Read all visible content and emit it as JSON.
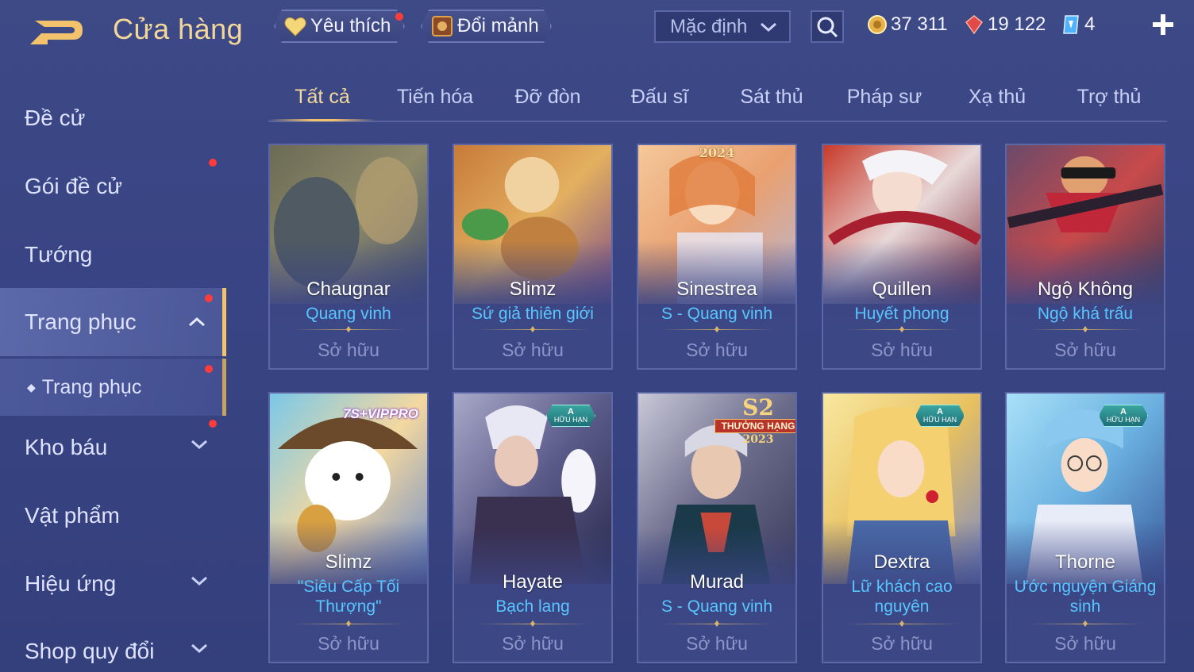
{
  "header": {
    "title": "Cửa hàng",
    "favorites_label": "Yêu thích",
    "exchange_label": "Đổi mảnh",
    "sort_value": "Mặc định",
    "gold": "37 311",
    "ruby": "19 122",
    "gems": "4"
  },
  "sidebar": {
    "items": [
      {
        "label": "Đề cử"
      },
      {
        "label": "Gói đề cử"
      },
      {
        "label": "Tướng"
      },
      {
        "label": "Trang phục"
      },
      {
        "label": "Trang phục"
      },
      {
        "label": "Kho báu"
      },
      {
        "label": "Vật phẩm"
      },
      {
        "label": "Hiệu ứng"
      },
      {
        "label": "Shop quy đổi"
      }
    ]
  },
  "tabs": [
    "Tất cả",
    "Tiến hóa",
    "Đỡ đòn",
    "Đấu sĩ",
    "Sát thủ",
    "Pháp sư",
    "Xạ thủ",
    "Trợ thủ"
  ],
  "cards": [
    {
      "hero": "Chaugnar",
      "skin": "Quang vinh",
      "status": "Sở hữu"
    },
    {
      "hero": "Slimz",
      "skin": "Sứ giả thiên giới",
      "status": "Sở hữu"
    },
    {
      "hero": "Sinestrea",
      "skin": "S - Quang vinh",
      "status": "Sở hữu",
      "badge": "2024"
    },
    {
      "hero": "Quillen",
      "skin": "Huyết phong",
      "status": "Sở hữu"
    },
    {
      "hero": "Ngộ Không",
      "skin": "Ngộ khá trấu",
      "status": "Sở hữu"
    },
    {
      "hero": "Slimz",
      "skin": "\"Siêu Cấp Tối Thượng\"",
      "status": "Sở hữu",
      "badge": "7S+VIPPRO"
    },
    {
      "hero": "Hayate",
      "skin": "Bạch lang",
      "status": "Sở hữu",
      "badge": "A",
      "badge_sub": "HỮU HẠN"
    },
    {
      "hero": "Murad",
      "skin": "S - Quang vinh",
      "status": "Sở hữu",
      "badge": "S2",
      "badge_sub": "THƯỞNG HẠNG",
      "badge_year": "2023"
    },
    {
      "hero": "Dextra",
      "skin": "Lữ khách cao nguyên",
      "status": "Sở hữu",
      "badge": "A",
      "badge_sub": "HỮU HẠN"
    },
    {
      "hero": "Thorne",
      "skin": "Ước nguyện Giáng sinh",
      "status": "Sở hữu",
      "badge": "A",
      "badge_sub": "HỮU HẠN"
    }
  ],
  "colors": {
    "accent_gold": "#f2c26d",
    "skin_name_blue": "#57c6ff",
    "notification_red": "#ff3b3b"
  }
}
